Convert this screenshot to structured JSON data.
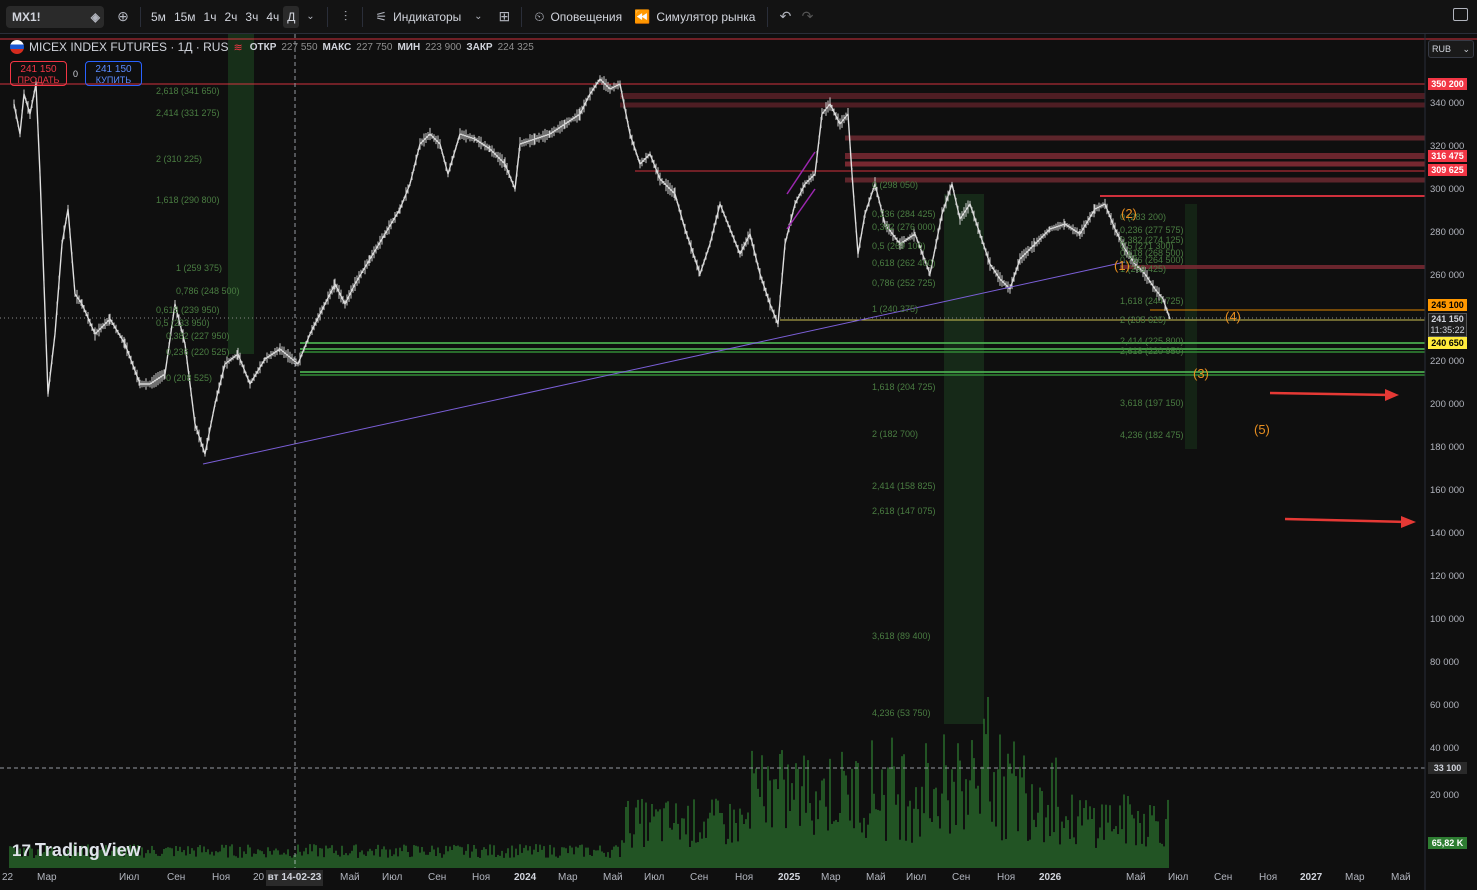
{
  "toolbar": {
    "symbol": "MX1!",
    "timeframes": [
      "5м",
      "15м",
      "1ч",
      "2ч",
      "3ч",
      "4ч",
      "Д"
    ],
    "active_timeframe": "Д",
    "indicators_label": "Индикаторы",
    "alerts_label": "Оповещения",
    "replay_label": "Симулятор рынка"
  },
  "legend": {
    "title": "MICEX INDEX FUTURES · 1Д · RUS",
    "open_label": "ОТКР",
    "open": "227 550",
    "high_label": "МАКС",
    "high": "227 750",
    "low_label": "МИН",
    "low": "223 900",
    "close_label": "ЗАКР",
    "close": "224 325"
  },
  "trade": {
    "sell_price": "241 150",
    "sell_label": "ПРОДАТЬ",
    "spread": "0",
    "buy_price": "241 150",
    "buy_label": "КУПИТЬ"
  },
  "currency": "RUB",
  "price_axis": [
    "340 000",
    "320 000",
    "300 000",
    "280 000",
    "260 000",
    "240 000",
    "220 000",
    "200 000",
    "180 000",
    "160 000",
    "140 000",
    "120 000",
    "100 000",
    "80 000",
    "60 000",
    "40 000",
    "20 000"
  ],
  "price_labels": {
    "level_350200": "350 200",
    "level_316475": "316 475",
    "level_309625": "309 625",
    "level_245100": "245 100",
    "last_price": "241 150",
    "countdown": "11:35:22",
    "level_240650": "240 650",
    "cursor_level": "33 100",
    "volume": "65,82 K"
  },
  "time_axis": [
    "22",
    "Мар",
    "Июл",
    "Сен",
    "Ноя",
    "20",
    "Май",
    "Июл",
    "Сен",
    "Ноя",
    "2024",
    "Мар",
    "Май",
    "Июл",
    "Сен",
    "Ноя",
    "2025",
    "Мар",
    "Май",
    "Июл",
    "Сен",
    "Ноя",
    "2026",
    "Май",
    "Июл",
    "Сен",
    "Ноя",
    "2027",
    "Мар",
    "Май"
  ],
  "time_cursor": "вт 14-02-23",
  "fib_left": [
    "2,618 (341 650)",
    "2,414 (331 275)",
    "2 (310 225)",
    "1,618 (290 800)",
    "1 (259 375)",
    "0,786 (248 500)",
    "0,618 (239 950)",
    "0,5 (233 950)",
    "0,382 (227 950)",
    "0,236 (220 525)",
    "0 (208 525)"
  ],
  "fib_mid": [
    "0 (298 050)",
    "0,236 (284 425)",
    "0,382 (276 000)",
    "0,5 (269 100)",
    "0,618 (262 400)",
    "0,786 (252 725)",
    "1 (240 375)",
    "1,618 (204 725)",
    "2 (182 700)",
    "2,414 (158 825)",
    "2,618 (147 075)",
    "3,618 (89 400)",
    "4,236 (53 750)"
  ],
  "fib_right": [
    "0 (283 200)",
    "0,236 (277 575)",
    "0,382 (274 125)",
    "0,5 (271 300)",
    "0,618 (268 500)",
    "0,786 (264 500)",
    "1 (259 425)",
    "1,618 (244 725)",
    "2 (235 625)",
    "2,414 (225 800)",
    "2,618 (220 950)",
    "3,618 (197 150)",
    "4,236 (182 475)"
  ],
  "waves": [
    "(1)",
    "(2)",
    "(3)",
    "(4)",
    "(5)"
  ],
  "brand": "TradingView",
  "colors": {
    "up": "#e0e0e0",
    "volume": "#2e7d32",
    "resistance": "#f23645",
    "support": "#4caf50",
    "trendline": "#7b5fd8",
    "wave": "#e88f21",
    "fib": "#4a7d42"
  }
}
